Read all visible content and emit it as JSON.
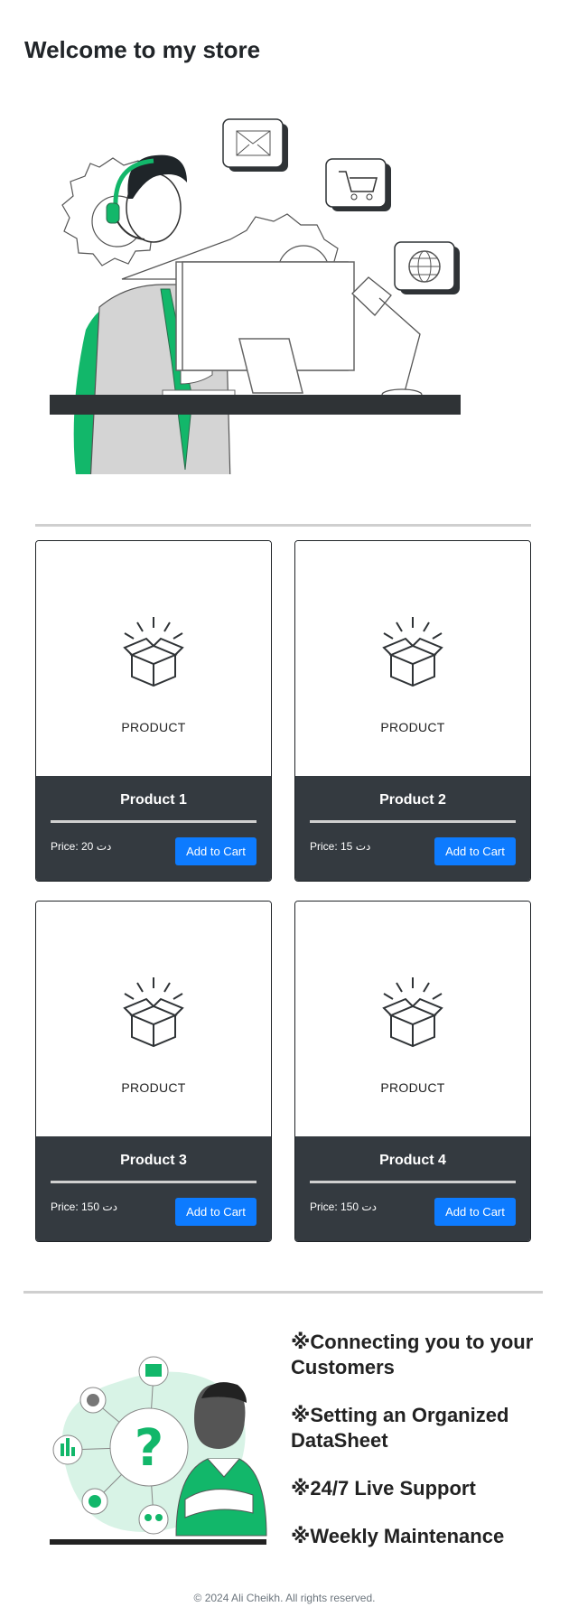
{
  "header": {
    "title": "Welcome to my store"
  },
  "products": [
    {
      "image_label": "PRODUCT",
      "name": "Product 1",
      "price": "Price: 20 دت",
      "button": "Add to Cart"
    },
    {
      "image_label": "PRODUCT",
      "name": "Product 2",
      "price": "Price: 15 دت",
      "button": "Add to Cart"
    },
    {
      "image_label": "PRODUCT",
      "name": "Product 3",
      "price": "Price: 150 دت",
      "button": "Add to Cart"
    },
    {
      "image_label": "PRODUCT",
      "name": "Product 4",
      "price": "Price: 150 دت",
      "button": "Add to Cart"
    }
  ],
  "features": [
    "※Connecting you to your Customers",
    "※Setting an Organized DataSheet",
    "※24/7 Live Support",
    "※Weekly Maintenance"
  ],
  "footer": {
    "text": "© 2024 Ali Cheikh. All rights reserved."
  },
  "colors": {
    "accent_green": "#12b76a",
    "card_dark": "#343a40",
    "button_blue": "#0d7bff"
  },
  "icons": [
    "envelope-icon",
    "cart-icon",
    "globe-icon",
    "gear-icon",
    "box-icon",
    "question-icon"
  ]
}
